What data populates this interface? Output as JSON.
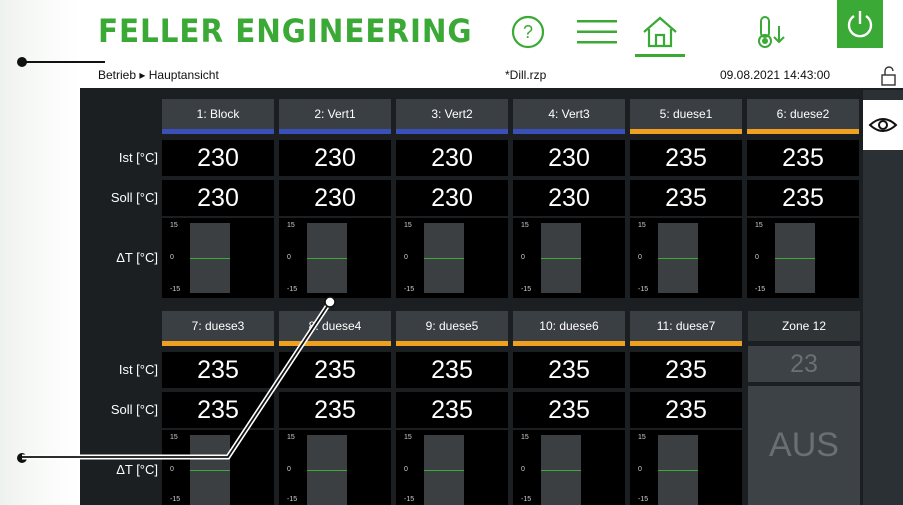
{
  "header": {
    "brand": "FELLER ENGINEERING",
    "icons": [
      "help-icon",
      "menu-icon",
      "home-icon",
      "temperature-down-icon",
      "power-icon"
    ]
  },
  "status": {
    "breadcrumb_section": "Betrieb",
    "breadcrumb_arrow": "▸",
    "breadcrumb_page": "Hauptansicht",
    "file": "*Dill.rzp",
    "datetime": "09.08.2021 14:43:00"
  },
  "row_labels": {
    "ist": "Ist [°C]",
    "soll": "Soll [°C]",
    "delta": "ΔT [°C]"
  },
  "graph_ticks": {
    "top": "15",
    "mid": "0",
    "bottom": "-15"
  },
  "colors": {
    "brand": "#3aa935",
    "heated_blue": "#3b4fb8",
    "heated_orange": "#f0a020"
  },
  "zones_row1": [
    {
      "name": "1: Block",
      "ist": "230",
      "soll": "230",
      "accent": "blue"
    },
    {
      "name": "2: Vert1",
      "ist": "230",
      "soll": "230",
      "accent": "blue"
    },
    {
      "name": "3: Vert2",
      "ist": "230",
      "soll": "230",
      "accent": "blue"
    },
    {
      "name": "4: Vert3",
      "ist": "230",
      "soll": "230",
      "accent": "blue"
    },
    {
      "name": "5: duese1",
      "ist": "235",
      "soll": "235",
      "accent": "orange"
    },
    {
      "name": "6: duese2",
      "ist": "235",
      "soll": "235",
      "accent": "orange"
    }
  ],
  "zones_row2": [
    {
      "name": "7: duese3",
      "ist": "235",
      "soll": "235",
      "accent": "orange"
    },
    {
      "name": "8: duese4",
      "ist": "235",
      "soll": "235",
      "accent": "orange"
    },
    {
      "name": "9: duese5",
      "ist": "235",
      "soll": "235",
      "accent": "orange"
    },
    {
      "name": "10: duese6",
      "ist": "235",
      "soll": "235",
      "accent": "orange"
    },
    {
      "name": "11: duese7",
      "ist": "235",
      "soll": "235",
      "accent": "orange"
    }
  ],
  "zone12": {
    "name": "Zone 12",
    "value": "23",
    "state": "AUS"
  }
}
